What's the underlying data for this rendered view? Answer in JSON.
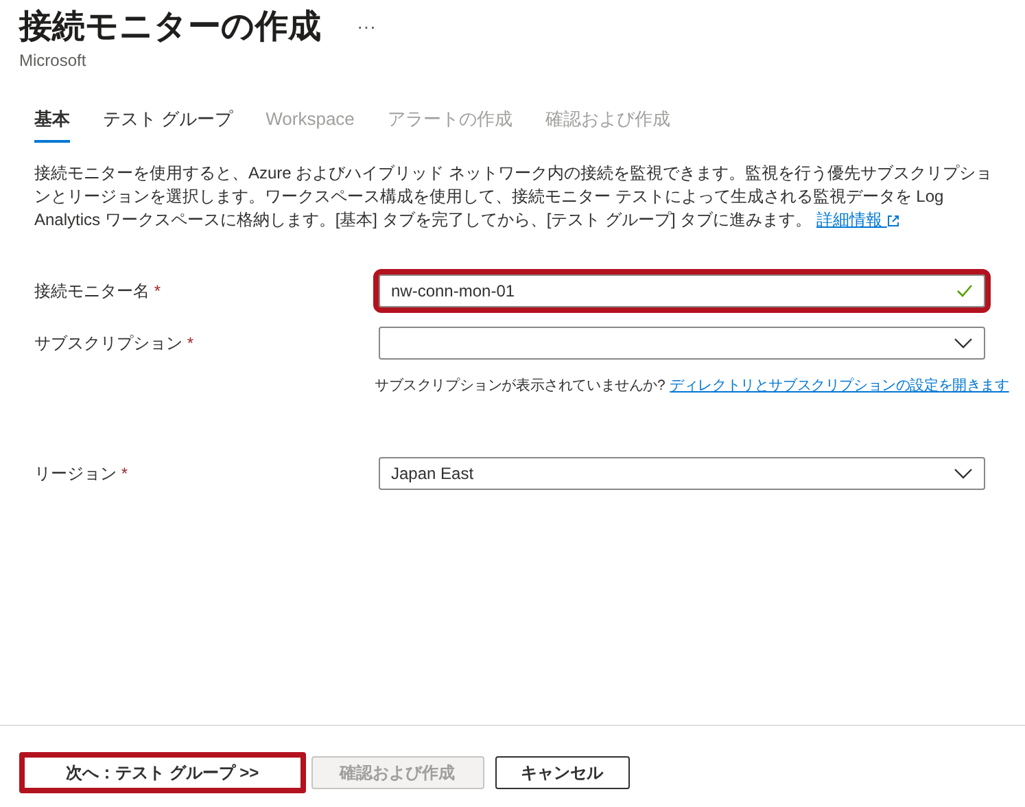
{
  "header": {
    "title": "接続モニターの作成",
    "more": "···",
    "publisher": "Microsoft"
  },
  "tabs": [
    {
      "label": "基本",
      "selected": true,
      "disabled": false
    },
    {
      "label": "テスト グループ",
      "selected": false,
      "disabled": false
    },
    {
      "label": "Workspace",
      "selected": false,
      "disabled": true
    },
    {
      "label": "アラートの作成",
      "selected": false,
      "disabled": true
    },
    {
      "label": "確認および作成",
      "selected": false,
      "disabled": true
    }
  ],
  "description": {
    "text": "接続モニターを使用すると、Azure およびハイブリッド ネットワーク内の接続を監視できます。監視を行う優先サブスクリプションとリージョンを選択します。ワークスペース構成を使用して、接続モニター テストによって生成される監視データを Log Analytics ワークスペースに格納します。[基本] タブを完了してから、[テスト グループ] タブに進みます。",
    "link": "詳細情報"
  },
  "fields": [
    {
      "kind": "text",
      "label": "接続モニター名",
      "required_mark": "*",
      "value": "nw-conn-mon-01",
      "valid": true,
      "highlighted": true
    },
    {
      "kind": "select",
      "label": "サブスクリプション",
      "required_mark": "*",
      "highlighted": false,
      "note": "サブスクリプションが表示されていませんか?",
      "note_link": "ディレクトリとサブスクリプションの設定を開きます"
    },
    {
      "kind": "select",
      "label": "リージョン",
      "required_mark": "*",
      "value": "Japan East",
      "highlighted": false
    }
  ],
  "buttons": [
    {
      "label": "次へ：テスト グループ >>",
      "disabled": false,
      "highlighted": true
    },
    {
      "label": "確認および作成",
      "disabled": true,
      "highlighted": false
    },
    {
      "label": "キャンセル",
      "disabled": false,
      "highlighted": false
    }
  ]
}
